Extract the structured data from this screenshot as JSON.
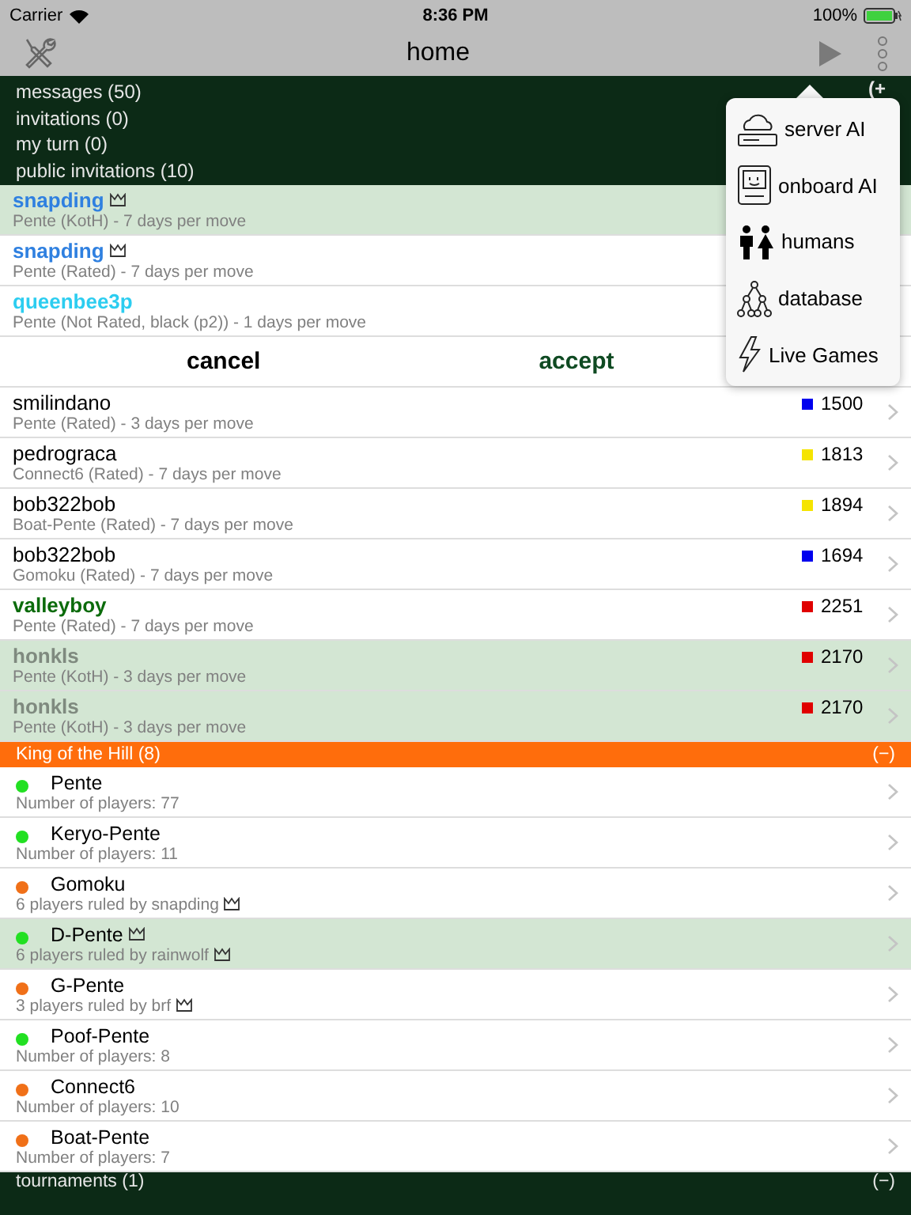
{
  "status_bar": {
    "carrier": "Carrier",
    "time": "8:36 PM",
    "battery": "100%"
  },
  "nav": {
    "title": "home"
  },
  "summary": {
    "lines": [
      "messages (50)",
      "invitations (0)",
      "my turn (0)",
      "public invitations (10)"
    ],
    "toggle": "(+"
  },
  "invitations": [
    {
      "name": "snapding",
      "color": "#2f80e0",
      "crown": true,
      "detail": "Pente (KotH) - 7  days per move",
      "highlighted": true
    },
    {
      "name": "snapding",
      "color": "#2f80e0",
      "crown": true,
      "detail": "Pente (Rated) - 7  days per move",
      "highlighted": false
    },
    {
      "name": "queenbee3p",
      "color": "#2ccdf0",
      "crown": false,
      "detail": "Pente (Not Rated, black (p2)) - 1  days per move",
      "highlighted": false,
      "actions": [
        {
          "label": "cancel",
          "kind": "neutral"
        },
        {
          "label": "accept",
          "kind": "confirm"
        }
      ]
    }
  ],
  "games": [
    {
      "name": "smilindano",
      "color": "#000000",
      "bold": false,
      "detail": "Pente (Rated) - 3  days per move",
      "rating": {
        "text": "1500",
        "color": "#0000ee"
      },
      "highlighted": false
    },
    {
      "name": "pedrograca",
      "color": "#000000",
      "bold": false,
      "detail": "Connect6 (Rated) - 7  days per move",
      "rating": {
        "text": "1813",
        "color": "#f5e400"
      },
      "highlighted": false
    },
    {
      "name": "bob322bob",
      "color": "#000000",
      "bold": false,
      "detail": "Boat-Pente (Rated) - 7  days per move",
      "rating": {
        "text": "1894",
        "color": "#f5e400"
      },
      "highlighted": false
    },
    {
      "name": "bob322bob",
      "color": "#000000",
      "bold": false,
      "detail": "Gomoku (Rated) - 7  days per move",
      "rating": {
        "text": "1694",
        "color": "#0000ee"
      },
      "highlighted": false
    },
    {
      "name": "valleyboy",
      "color": "#0b6b0b",
      "bold": true,
      "detail": "Pente (Rated) - 7  days per move",
      "rating": {
        "text": "2251",
        "color": "#e00000"
      },
      "highlighted": false
    },
    {
      "name": "honkls",
      "color": "#7f8a7f",
      "bold": true,
      "detail": "Pente (KotH) - 3  days per move",
      "rating": {
        "text": "2170",
        "color": "#e00000"
      },
      "highlighted": true
    },
    {
      "name": "honkls",
      "color": "#7f8a7f",
      "bold": true,
      "detail": "Pente (KotH) - 3  days per move",
      "rating": {
        "text": "2170",
        "color": "#e00000"
      },
      "highlighted": true
    }
  ],
  "koth": {
    "title": "King of the Hill (8)",
    "toggle": "(−)",
    "items": [
      {
        "name": "Pente",
        "crown": false,
        "detail": "Number of players: 77",
        "detail_crown": false,
        "color": "#22e022",
        "highlighted": false
      },
      {
        "name": "Keryo-Pente",
        "crown": false,
        "detail": "Number of players: 11",
        "detail_crown": false,
        "color": "#22e022",
        "highlighted": false
      },
      {
        "name": "Gomoku",
        "crown": false,
        "detail": "6 players ruled by snapding",
        "detail_crown": true,
        "color": "#f07018",
        "highlighted": false
      },
      {
        "name": "D-Pente",
        "crown": true,
        "detail": "6 players ruled by rainwolf",
        "detail_crown": true,
        "color": "#22e022",
        "highlighted": true
      },
      {
        "name": "G-Pente",
        "crown": false,
        "detail": "3 players ruled by brf",
        "detail_crown": true,
        "color": "#f07018",
        "highlighted": false
      },
      {
        "name": "Poof-Pente",
        "crown": false,
        "detail": "Number of players: 8",
        "detail_crown": false,
        "color": "#22e022",
        "highlighted": false
      },
      {
        "name": "Connect6",
        "crown": false,
        "detail": "Number of players: 10",
        "detail_crown": false,
        "color": "#f07018",
        "highlighted": false
      },
      {
        "name": "Boat-Pente",
        "crown": false,
        "detail": "Number of players: 7",
        "detail_crown": false,
        "color": "#f07018",
        "highlighted": false
      }
    ]
  },
  "tournaments": {
    "title": "tournaments (1)",
    "toggle": "(−)"
  },
  "menu": [
    {
      "label": "server AI",
      "kind": "server"
    },
    {
      "label": "onboard AI",
      "kind": "computer"
    },
    {
      "label": "humans",
      "kind": "people"
    },
    {
      "label": "database",
      "kind": "tree"
    },
    {
      "label": "Live Games",
      "kind": "bolt"
    }
  ]
}
